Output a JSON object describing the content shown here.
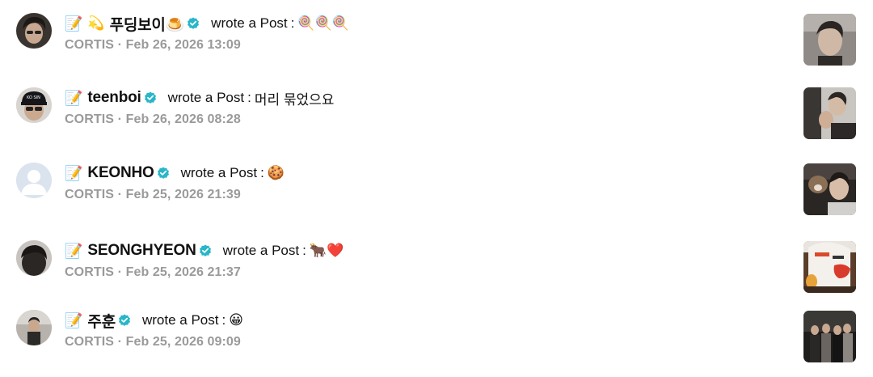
{
  "feed": {
    "items": [
      {
        "prefix_emoji": "📝",
        "extra_emoji": "💫",
        "username": "푸딩보이🍮",
        "action": "wrote a Post",
        "colon": ":",
        "content": "🍭🍭🍭",
        "group": "CORTIS",
        "separator": "·",
        "timestamp": "Feb 26, 2026 13:09"
      },
      {
        "prefix_emoji": "📝",
        "extra_emoji": "",
        "username": "teenboi",
        "action": "wrote a Post",
        "colon": ":",
        "content": "머리 묶었으요",
        "group": "CORTIS",
        "separator": "·",
        "timestamp": "Feb 26, 2026 08:28"
      },
      {
        "prefix_emoji": "📝",
        "extra_emoji": "",
        "username": "KEONHO",
        "action": "wrote a Post",
        "colon": ":",
        "content": "🍪",
        "group": "CORTIS",
        "separator": "·",
        "timestamp": "Feb 25, 2026 21:39"
      },
      {
        "prefix_emoji": "📝",
        "extra_emoji": "",
        "username": "SEONGHYEON",
        "action": "wrote a Post",
        "colon": ":",
        "content": "🐂❤️",
        "group": "CORTIS",
        "separator": "·",
        "timestamp": "Feb 25, 2026 21:37"
      },
      {
        "prefix_emoji": "📝",
        "extra_emoji": "",
        "username": "주훈",
        "action": "wrote a Post",
        "colon": ":",
        "content": "😀",
        "group": "CORTIS",
        "separator": "·",
        "timestamp": "Feb 25, 2026 09:09"
      }
    ]
  },
  "colors": {
    "verified_badge": "#29b6c8",
    "meta_text": "#9a9a9a"
  }
}
